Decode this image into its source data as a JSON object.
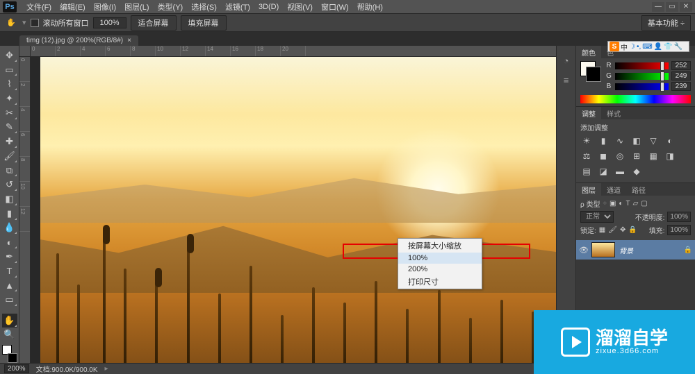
{
  "menubar": {
    "logo": "Ps",
    "items": [
      "文件(F)",
      "编辑(E)",
      "图像(I)",
      "图层(L)",
      "类型(Y)",
      "选择(S)",
      "滤镜(T)",
      "3D(D)",
      "视图(V)",
      "窗口(W)",
      "帮助(H)"
    ]
  },
  "optionbar": {
    "scroll_all_label": "滚动所有窗口",
    "zoom_value": "100%",
    "fit_screen": "适合屏幕",
    "fill_screen": "填充屏幕",
    "workspace": "基本功能"
  },
  "document": {
    "tab_title": "timg (12).jpg @ 200%(RGB/8#)"
  },
  "ruler_h": [
    "0",
    "2",
    "4",
    "6",
    "8",
    "10",
    "12",
    "14",
    "16",
    "18",
    "20"
  ],
  "ruler_v": [
    "0",
    "2",
    "4",
    "6",
    "8",
    "10",
    "12"
  ],
  "context_menu": {
    "items": [
      "按屏幕大小缩放",
      "100%",
      "200%",
      "打印尺寸"
    ],
    "highlighted_index": 1
  },
  "panels": {
    "color": {
      "tabs": [
        "颜色",
        "色"
      ],
      "r": {
        "label": "R",
        "value": "252"
      },
      "g": {
        "label": "G",
        "value": "249"
      },
      "b": {
        "label": "B",
        "value": "239"
      }
    },
    "adjust": {
      "tabs": [
        "调整",
        "样式"
      ],
      "title": "添加调整"
    },
    "layers": {
      "tabs": [
        "图层",
        "通道",
        "路径"
      ],
      "kind_label": "ρ 类型",
      "blend_mode": "正常",
      "opacity_label": "不透明度:",
      "opacity_value": "100%",
      "lock_label": "锁定:",
      "fill_label": "填充:",
      "fill_value": "100%",
      "layer_name": "背景"
    }
  },
  "status": {
    "zoom": "200%",
    "doc_info": "文档:900.0K/900.0K"
  },
  "ime": {
    "logo": "S",
    "lang": "中"
  },
  "watermark": {
    "title": "溜溜自学",
    "sub": "zixue.3d66.com"
  }
}
